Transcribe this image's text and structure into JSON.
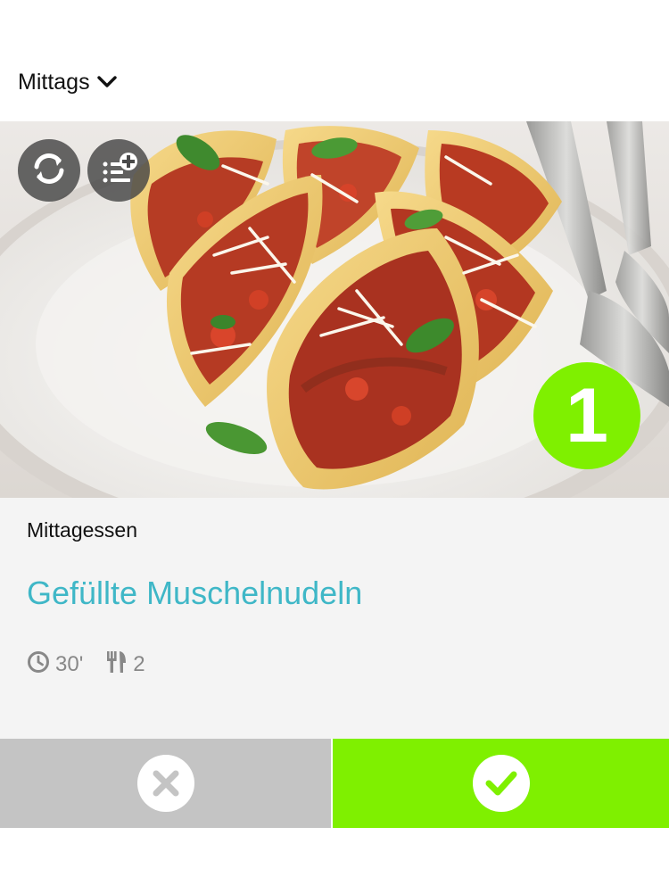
{
  "header": {
    "meal_label": "Mittags"
  },
  "recipe": {
    "category": "Mittagessen",
    "title": "Gefüllte Muschelnudeln",
    "time": "30'",
    "servings": "2",
    "rank": "1"
  },
  "icons": {
    "meal_dropdown": "chevron-down-icon",
    "refresh": "refresh-icon",
    "add_to_list": "add-to-list-icon",
    "time": "clock-icon",
    "servings": "cutlery-icon",
    "reject": "close-icon",
    "accept": "check-icon"
  },
  "colors": {
    "accent_green": "#7ff000",
    "title_teal": "#3fb7c7",
    "reject_gray": "#c4c4c4",
    "meta_gray": "#888888"
  }
}
